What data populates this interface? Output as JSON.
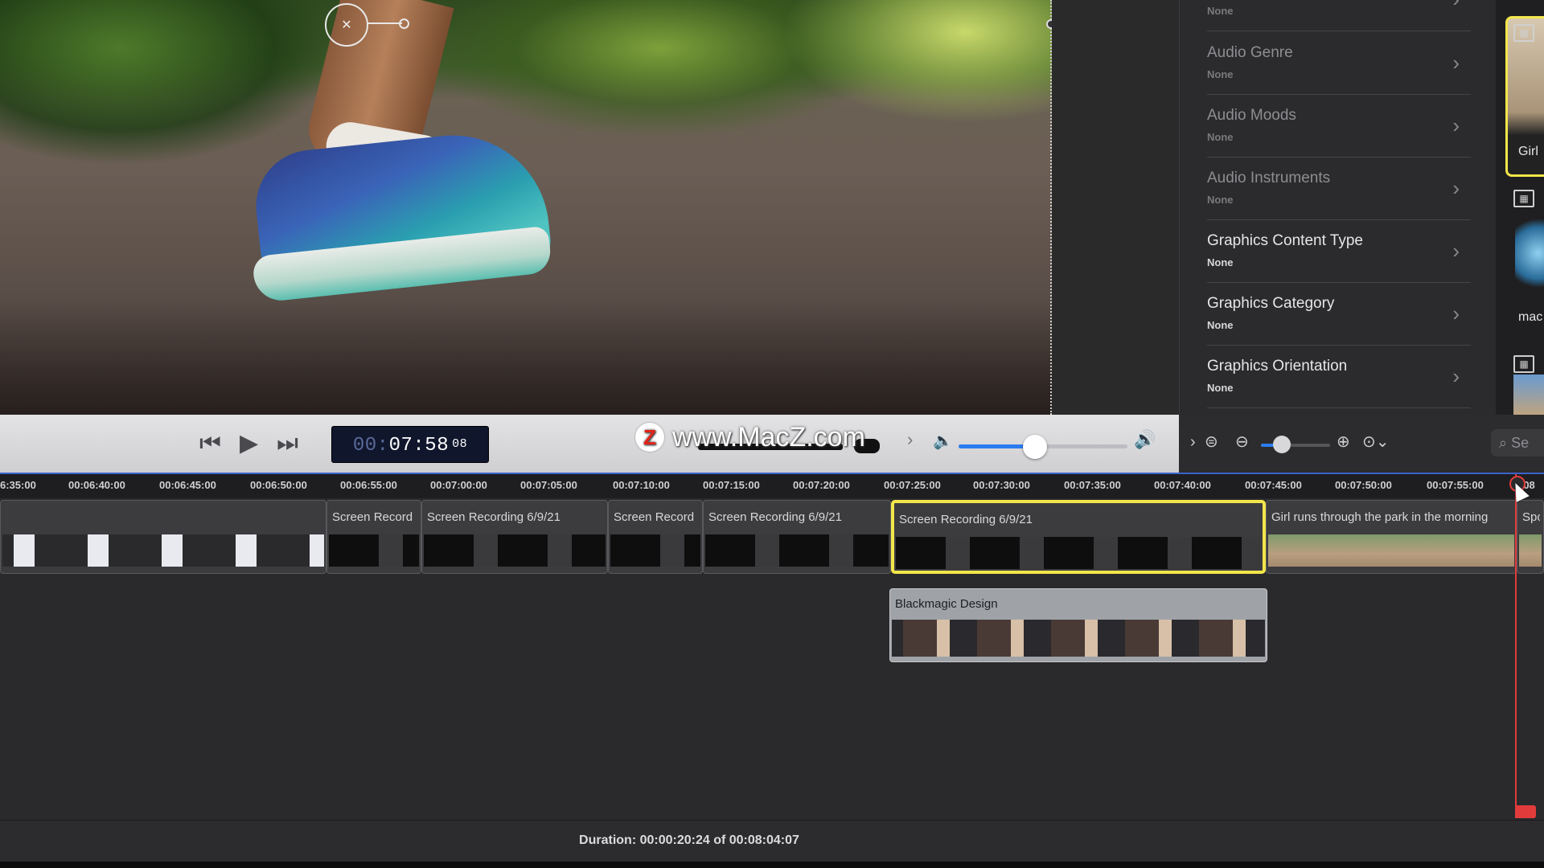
{
  "watermark": {
    "logo": "Z",
    "text": "www.MacZ.com"
  },
  "inspector": {
    "rows": [
      {
        "title": "",
        "value": "None",
        "dim": true
      },
      {
        "title": "Audio Genre",
        "value": "None",
        "dim": true
      },
      {
        "title": "Audio Moods",
        "value": "None",
        "dim": true
      },
      {
        "title": "Audio Instruments",
        "value": "None",
        "dim": true
      },
      {
        "title": "Graphics Content Type",
        "value": "None",
        "dim": false
      },
      {
        "title": "Graphics Category",
        "value": "None",
        "dim": false
      },
      {
        "title": "Graphics Orientation",
        "value": "None",
        "dim": false
      }
    ]
  },
  "browser": {
    "labels": [
      "Girl",
      "mac"
    ]
  },
  "transport": {
    "timecode_prefix": "00:",
    "timecode_main": "07:58",
    "timecode_frames": "08",
    "volume_level": 0.45
  },
  "tools": {
    "zoom_level": 0.3,
    "search_placeholder": "Se"
  },
  "ruler": {
    "ticks": [
      "6:35:00",
      "00:06:40:00",
      "00:06:45:00",
      "00:06:50:00",
      "00:06:55:00",
      "00:07:00:00",
      "00:07:05:00",
      "00:07:10:00",
      "00:07:15:00",
      "00:07:20:00",
      "00:07:25:00",
      "00:07:30:00",
      "00:07:35:00",
      "00:07:40:00",
      "00:07:45:00",
      "00:07:50:00",
      "00:07:55:00",
      ":08"
    ]
  },
  "timeline": {
    "clips": [
      {
        "label": "",
        "style": "light"
      },
      {
        "label": "Screen Record",
        "style": "dark"
      },
      {
        "label": "Screen Recording 6/9/21",
        "style": "dark"
      },
      {
        "label": "Screen Record",
        "style": "dark"
      },
      {
        "label": "Screen Recording 6/9/21",
        "style": "dark"
      },
      {
        "label": "Screen Recording 6/9/21",
        "style": "dark",
        "selected": true
      },
      {
        "label": "Girl runs through the park in the morning",
        "style": "park"
      },
      {
        "label": "Spo",
        "style": "park"
      }
    ],
    "connected_clip": {
      "label": "Blackmagic Design"
    }
  },
  "status": {
    "duration": "Duration: 00:00:20:24 of 00:08:04:07"
  },
  "colors": {
    "selection": "#f2e64a",
    "playhead": "#e23b3b",
    "accent": "#2a7cf0"
  }
}
